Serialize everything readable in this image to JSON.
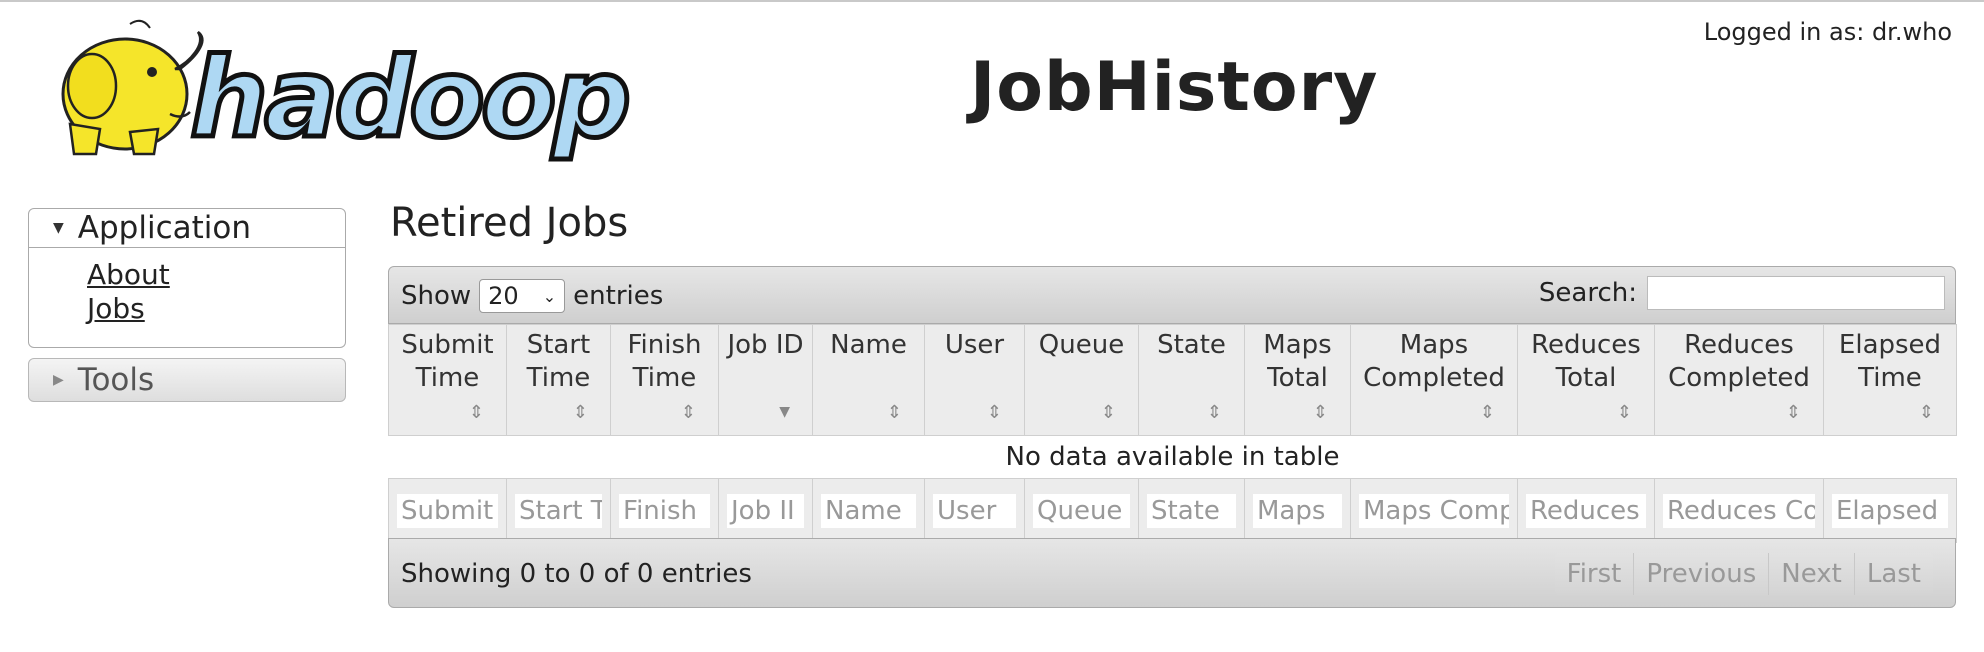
{
  "header": {
    "logo_text": "hadoop",
    "logged_in": "Logged in as: dr.who",
    "title": "JobHistory"
  },
  "sidebar": {
    "application": {
      "label": "Application",
      "links": [
        "About",
        "Jobs"
      ]
    },
    "tools": {
      "label": "Tools"
    }
  },
  "main": {
    "section_title": "Retired Jobs",
    "show_label": "Show",
    "entries_label": "entries",
    "page_length": "20",
    "search_label": "Search:",
    "search_value": "",
    "columns": [
      {
        "label": "Submit Time",
        "filter": "Submit"
      },
      {
        "label": "Start Time",
        "filter": "Start T"
      },
      {
        "label": "Finish Time",
        "filter": "Finish"
      },
      {
        "label": "Job ID",
        "filter": "Job II"
      },
      {
        "label": "Name",
        "filter": "Name"
      },
      {
        "label": "User",
        "filter": "User"
      },
      {
        "label": "Queue",
        "filter": "Queue"
      },
      {
        "label": "State",
        "filter": "State"
      },
      {
        "label": "Maps Total",
        "filter": "Maps "
      },
      {
        "label": "Maps Completed",
        "filter": "Maps Comp"
      },
      {
        "label": "Reduces Total",
        "filter": "Reduces"
      },
      {
        "label": "Reduces Completed",
        "filter": "Reduces Co"
      },
      {
        "label": "Elapsed Time",
        "filter": "Elapsed"
      }
    ],
    "empty_message": "No data available in table",
    "info": "Showing 0 to 0 of 0 entries",
    "pagination": [
      "First",
      "Previous",
      "Next",
      "Last"
    ]
  }
}
